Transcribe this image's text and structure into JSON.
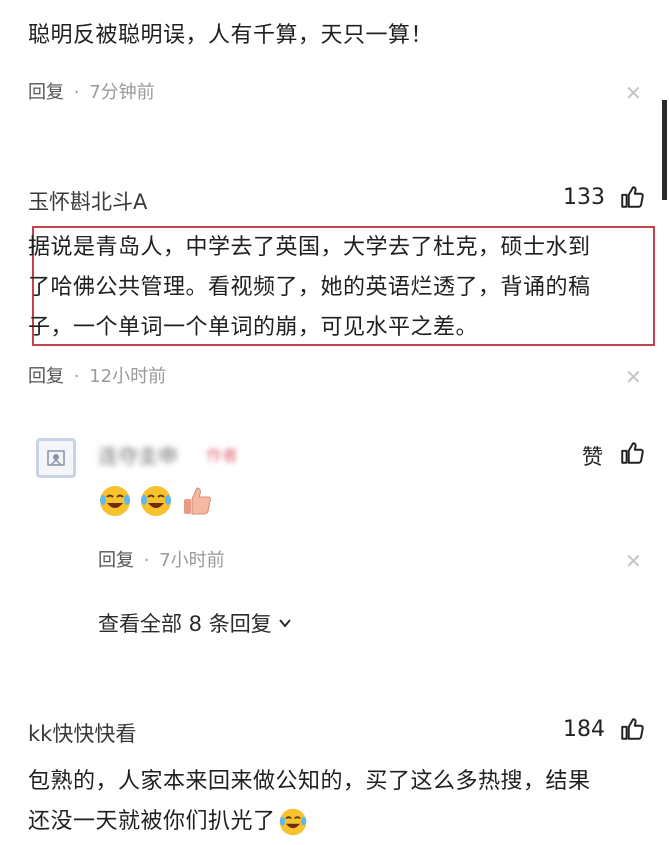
{
  "comments": [
    {
      "text": "聪明反被聪明误，人有千算，天只一算！",
      "reply_label": "回复",
      "separator": "·",
      "time": "7分钟前"
    },
    {
      "username": "玉怀斟北斗A",
      "likes": "133",
      "text_lines": [
        "据说是青岛人，中学去了英国，大学去了杜克，硕士水到",
        "了哈佛公共管理。看视频了，她的英语烂透了，背诵的稿",
        "子，一个单词一个单词的崩，可见水平之差。"
      ],
      "reply_label": "回复",
      "separator": "·",
      "time": "12小时前",
      "sub_reply": {
        "username": "连夺圭申",
        "author_badge": "作者",
        "like_label": "赞",
        "reply_label": "回复",
        "separator": "·",
        "time": "7小时前"
      },
      "view_all": "查看全部 8 条回复"
    },
    {
      "username": "kk快快快看",
      "likes": "184",
      "text_lines": [
        "包熟的，人家本来回来做公知的，买了这么多热搜，结果",
        "还没一天就被你们扒光了"
      ]
    }
  ],
  "icons": {
    "close": "close-icon",
    "like": "thumbs-up-icon",
    "chevron": "chevron-down-icon",
    "emoji_laugh": "laughing-tears-emoji",
    "emoji_thumb": "thumbs-up-emoji"
  },
  "colors": {
    "highlight_border": "#c0424a",
    "meta_text": "#9a9a9a",
    "author_badge": "#e0707a"
  }
}
